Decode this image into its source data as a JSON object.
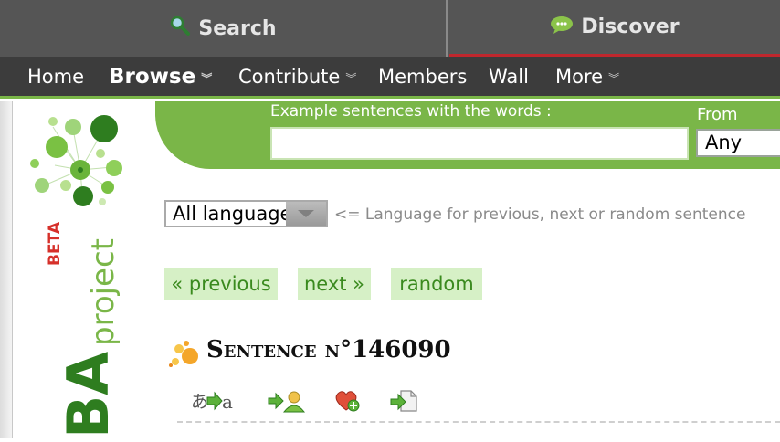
{
  "topbar": {
    "search_label": "Search",
    "discover_label": "Discover",
    "search_icon": "magnifier-icon",
    "discover_icon": "chat-bubble-icon"
  },
  "menu": {
    "items": [
      {
        "label": "Home",
        "dropdown": false
      },
      {
        "label": "Browse",
        "dropdown": true,
        "active": true
      },
      {
        "label": "Contribute",
        "dropdown": true
      },
      {
        "label": "Members",
        "dropdown": false
      },
      {
        "label": "Wall",
        "dropdown": false
      },
      {
        "label": "More",
        "dropdown": true
      }
    ]
  },
  "logo": {
    "beta": "BETA",
    "project": "project",
    "ba": "BA"
  },
  "search": {
    "label": "Example sentences with the words :",
    "value": "",
    "from_label": "From",
    "from_value": "Any"
  },
  "language_filter": {
    "selected": "All languages",
    "hint": "<= Language for previous, next or random sentence"
  },
  "navigation": {
    "previous": "« previous",
    "next": "next »",
    "random": "random"
  },
  "sentence": {
    "title": "Sentence n°146090"
  },
  "tools": {
    "translate": "translate-icon",
    "adopt": "adopt-icon",
    "favorite": "favorite-icon",
    "add_to_list": "add-to-list-icon"
  },
  "colors": {
    "accent_green": "#7ab648",
    "topbar": "#555555",
    "menubar": "#3c3c3c",
    "discover_underline": "#c0272d",
    "nav_button_bg": "#d6f0c6",
    "nav_button_text": "#3a8a1e"
  }
}
